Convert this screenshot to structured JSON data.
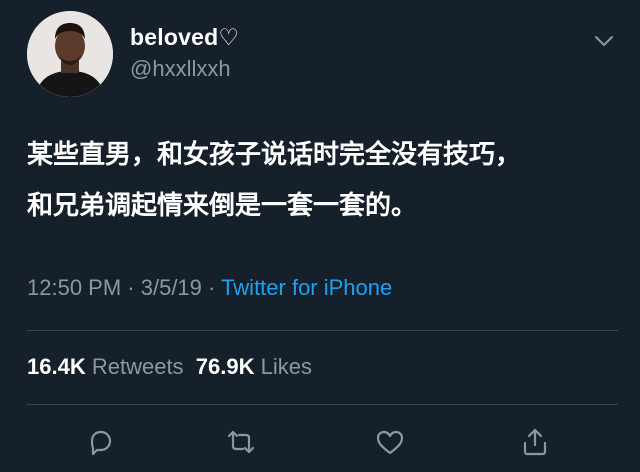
{
  "user": {
    "display_name": "beloved♡",
    "handle": "@hxxllxxh"
  },
  "tweet": {
    "line1": "某些直男，和女孩子说话时完全没有技巧，",
    "line2": "和兄弟调起情来倒是一套一套的。",
    "time": "12:50 PM",
    "sep1": " · ",
    "date": "3/5/19",
    "sep2": " · ",
    "source": "Twitter for iPhone"
  },
  "stats": {
    "retweets_count": "16.4K",
    "retweets_label": "Retweets",
    "likes_count": "76.9K",
    "likes_label": "Likes"
  },
  "icons": {
    "menu": "chevron-down-icon",
    "reply": "reply-icon",
    "retweet": "retweet-icon",
    "like": "heart-icon",
    "share": "share-icon"
  },
  "colors": {
    "background": "#15202b",
    "secondary_text": "#8899a6",
    "link": "#1da1f2",
    "divider": "#38444d"
  }
}
